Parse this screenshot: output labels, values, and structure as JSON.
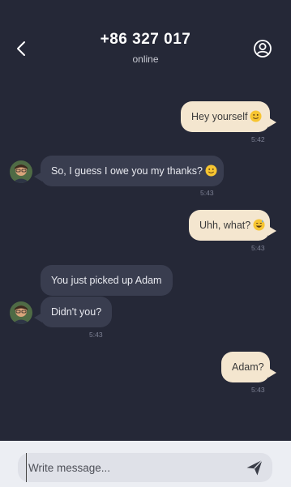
{
  "header": {
    "title": "+86 327 017",
    "status": "online",
    "back_icon": "chevron-left-icon",
    "profile_icon": "user-circle-icon"
  },
  "messages": [
    {
      "direction": "outgoing",
      "text": "Hey yourself",
      "emoji": "slightly-smiling-face",
      "time": "5:42"
    },
    {
      "direction": "incoming",
      "text": "So, I guess I owe you my thanks?",
      "emoji": "slightly-smiling-face",
      "time": "5:43"
    },
    {
      "direction": "outgoing",
      "text": "Uhh, what?",
      "emoji": "grinning-face-with-sweat",
      "time": "5:43"
    },
    {
      "direction": "incoming",
      "text": "You just picked up Adam",
      "time": ""
    },
    {
      "direction": "incoming",
      "text": "Didn't you?",
      "time": "5:43"
    },
    {
      "direction": "outgoing",
      "text": "Adam?",
      "time": "5:43"
    }
  ],
  "composer": {
    "placeholder": "Write message...",
    "value": "",
    "send_icon": "send-icon"
  },
  "colors": {
    "background": "#252837",
    "outgoing_bubble": "#f4e6cf",
    "incoming_bubble": "#393d4f",
    "composer_bg": "#eceef3"
  }
}
